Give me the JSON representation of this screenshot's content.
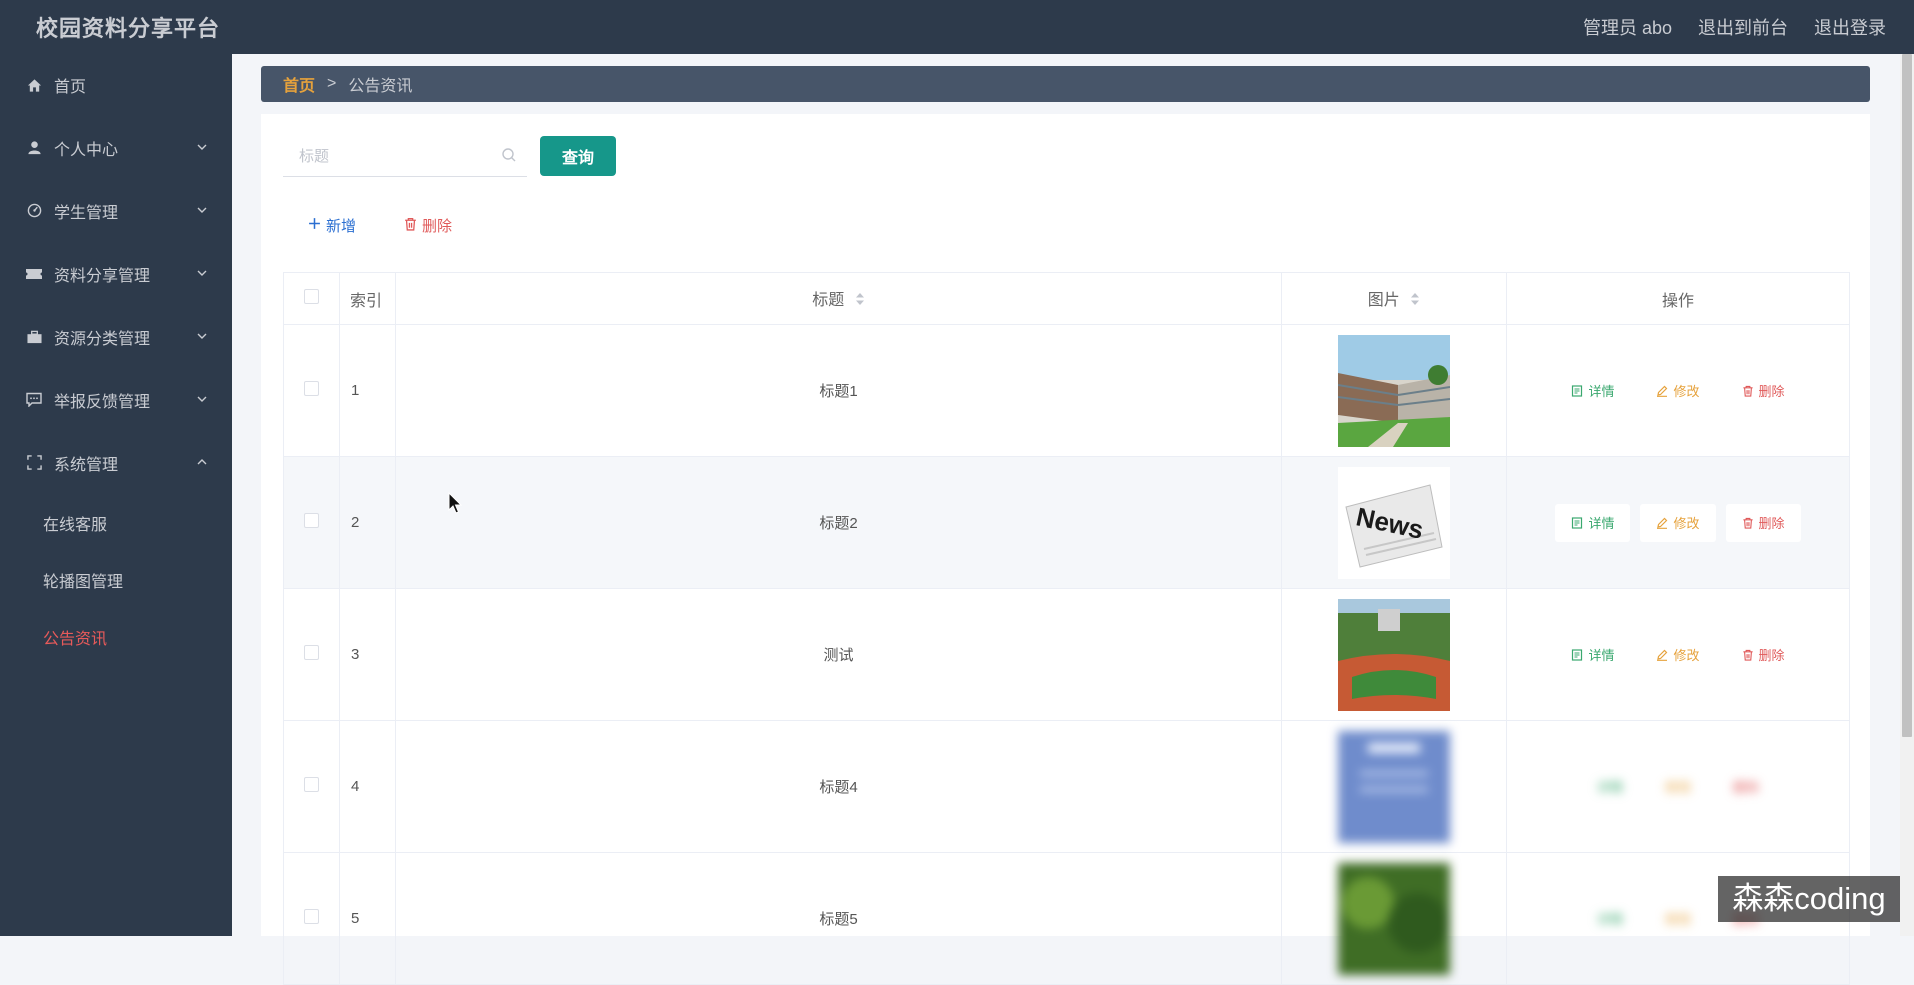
{
  "header": {
    "title": "校园资料分享平台",
    "admin_label": "管理员 abo",
    "front_link": "退出到前台",
    "logout_link": "退出登录"
  },
  "sidebar": {
    "items": [
      {
        "label": "首页",
        "icon": "home-icon"
      },
      {
        "label": "个人中心",
        "icon": "user-icon"
      },
      {
        "label": "学生管理",
        "icon": "student-icon"
      },
      {
        "label": "资料分享管理",
        "icon": "ticket-icon"
      },
      {
        "label": "资源分类管理",
        "icon": "briefcase-icon"
      },
      {
        "label": "举报反馈管理",
        "icon": "chat-icon"
      },
      {
        "label": "系统管理",
        "icon": "frame-icon"
      }
    ],
    "sub_items": [
      {
        "label": "在线客服"
      },
      {
        "label": "轮播图管理"
      },
      {
        "label": "公告资讯"
      }
    ]
  },
  "breadcrumb": {
    "home": "首页",
    "separator": ">",
    "current": "公告资讯"
  },
  "search": {
    "placeholder": "标题",
    "value": "",
    "button": "查询"
  },
  "actions": {
    "add": "新增",
    "delete": "删除"
  },
  "table": {
    "columns": [
      "索引",
      "标题",
      "图片",
      "操作"
    ],
    "rows": [
      {
        "index": "1",
        "title": "标题1",
        "image": "campus-buildings"
      },
      {
        "index": "2",
        "title": "标题2",
        "image": "news-newspaper"
      },
      {
        "index": "3",
        "title": "测试",
        "image": "running-track"
      },
      {
        "index": "4",
        "title": "标题4",
        "image": "blue-poster"
      },
      {
        "index": "5",
        "title": "标题5",
        "image": "green-trees"
      }
    ],
    "row_actions": {
      "detail": "详情",
      "edit": "修改",
      "delete": "删除"
    }
  },
  "watermark": "森森coding",
  "colors": {
    "sidebar_bg": "#2d3a4b",
    "accent_green": "#16978a",
    "breadcrumb_home": "#e6a23c",
    "active_menu": "#e85a5a",
    "detail": "#3aa86f",
    "edit": "#e6a23c",
    "delete": "#e05a5a"
  }
}
